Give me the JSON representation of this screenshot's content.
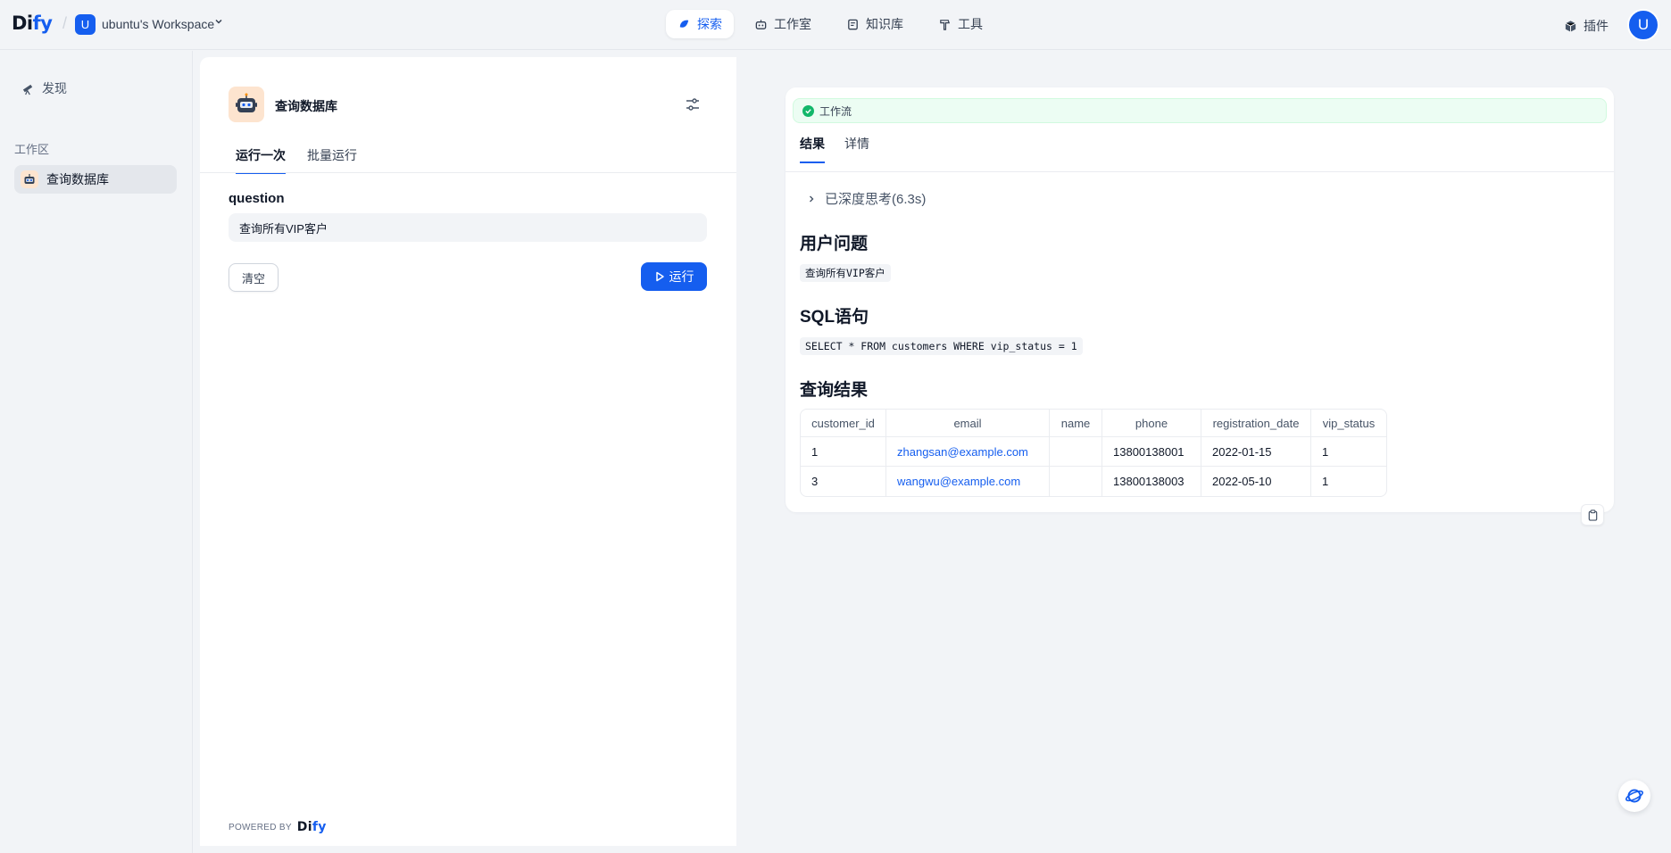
{
  "header": {
    "logo_main": "Di",
    "logo_accent": "fy",
    "workspace_initial": "U",
    "workspace_name": "ubuntu's Workspace",
    "nav": [
      {
        "label": "探索",
        "icon": "explore-icon",
        "active": true
      },
      {
        "label": "工作室",
        "icon": "robot-icon",
        "active": false
      },
      {
        "label": "知识库",
        "icon": "book-icon",
        "active": false
      },
      {
        "label": "工具",
        "icon": "hammer-icon",
        "active": false
      }
    ],
    "plugin_label": "插件",
    "user_initial": "U"
  },
  "sidebar": {
    "discover_label": "发现",
    "section_label": "工作区",
    "items": [
      {
        "label": "查询数据库",
        "active": true
      }
    ]
  },
  "app": {
    "title": "查询数据库",
    "tabs": [
      {
        "label": "运行一次",
        "active": true
      },
      {
        "label": "批量运行",
        "active": false
      }
    ],
    "field_label": "question",
    "field_value": "查询所有VIP客户",
    "clear_label": "清空",
    "run_label": "运行",
    "powered_by": "POWERED BY",
    "powered_logo_main": "Di",
    "powered_logo_accent": "fy"
  },
  "result": {
    "workflow_label": "工作流",
    "tabs": [
      {
        "label": "结果",
        "active": true
      },
      {
        "label": "详情",
        "active": false
      }
    ],
    "thinking_label": "已深度思考(6.3s)",
    "question_heading": "用户问题",
    "question_text": "查询所有VIP客户",
    "sql_heading": "SQL语句",
    "sql_text": "SELECT * FROM customers WHERE vip_status = 1",
    "result_heading": "查询结果",
    "table": {
      "columns": [
        "customer_id",
        "email",
        "name",
        "phone",
        "registration_date",
        "vip_status"
      ],
      "rows": [
        [
          "1",
          "zhangsan@example.com",
          "",
          "13800138001",
          "2022-01-15",
          "1"
        ],
        [
          "3",
          "wangwu@example.com",
          "",
          "13800138003",
          "2022-05-10",
          "1"
        ]
      ]
    }
  },
  "colors": {
    "accent": "#155eef",
    "success": "#12b76a",
    "badge_bg": "#ecfdf3"
  }
}
